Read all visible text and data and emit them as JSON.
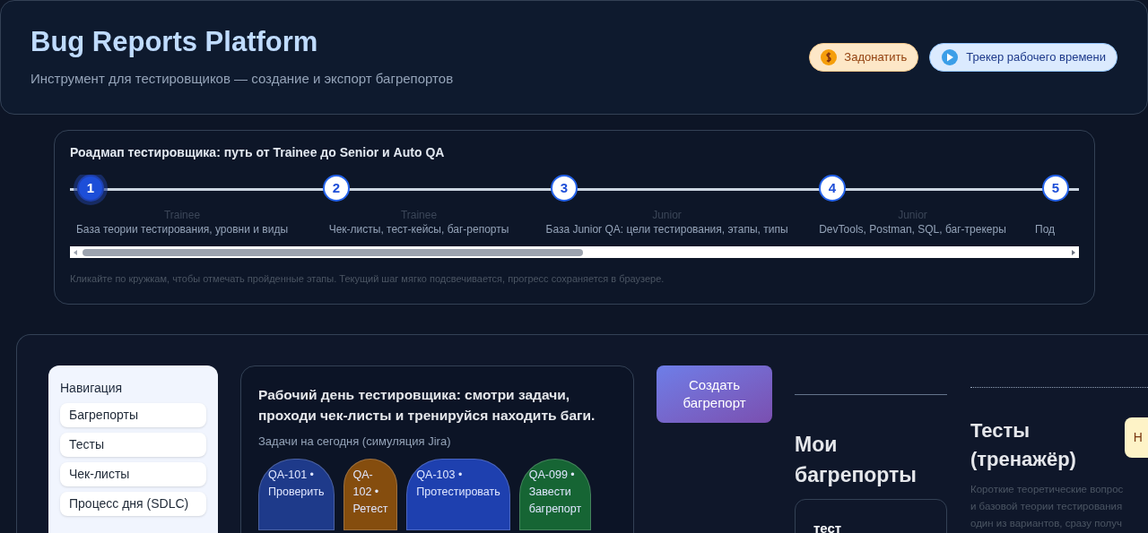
{
  "header": {
    "title": "Bug Reports Platform",
    "subtitle": "Инструмент для тестировщиков — создание и экспорт багрепортов",
    "buttons": [
      {
        "kind": "donate",
        "label": "Задонатить"
      },
      {
        "kind": "tracker",
        "label": "Трекер рабочего времени"
      }
    ]
  },
  "roadmap": {
    "title": "Роадмап тестировщика: путь от Trainee до Senior и Auto QA",
    "steps": [
      {
        "number": "1",
        "level": "Trainee",
        "title": "База теории тестирования, уровни и виды",
        "selected": true
      },
      {
        "number": "2",
        "level": "Trainee",
        "title": "Чек-листы, тест-кейсы, баг-репорты",
        "selected": false
      },
      {
        "number": "3",
        "level": "Junior",
        "title": "База Junior QA: цели тестирования, этапы, типы",
        "selected": false
      },
      {
        "number": "4",
        "level": "Junior",
        "title": "DevTools, Postman, SQL, баг-трекеры",
        "selected": false
      },
      {
        "number": "5",
        "title": "Под",
        "selected": false
      }
    ],
    "hint": "Кликайте по кружкам, чтобы отмечать пройденные этапы. Текущий шаг мягко подсвечивается, прогресс сохраняется в браузере."
  },
  "navigation": {
    "title": "Навигация",
    "items": [
      "Багрепорты",
      "Тесты",
      "Чек-листы",
      "Процесс дня (SDLC)"
    ]
  },
  "workday": {
    "title": "Рабочий день тестировщика: смотри задачи, проходи чек-листы и тренируйся находить баги.",
    "subtitle": "Задачи на сегодня (симуляция Jira)",
    "tasks": [
      {
        "lines": [
          "QA-101 •",
          "Проверить"
        ],
        "color": "#1e3a8a"
      },
      {
        "lines": [
          "QA-",
          "102 •",
          "Ретест"
        ],
        "color": "#854d0e"
      },
      {
        "lines": [
          "QA-103 •",
          "Протестировать"
        ],
        "color": "#1e40af"
      },
      {
        "lines": [
          "QA-099 •",
          "Завести",
          "багрепорт"
        ],
        "color": "#166534"
      }
    ]
  },
  "create_button": "Создать багрепорт",
  "my_reports": {
    "title": "Мои багрепорты",
    "cards": [
      "тест"
    ]
  },
  "tests": {
    "title": "Тесты (тренажёр)",
    "button": "Н",
    "description": [
      "Короткие теоретические вопрос",
      "и базовой теории тестирования",
      "один из вариантов, сразу получ"
    ]
  }
}
